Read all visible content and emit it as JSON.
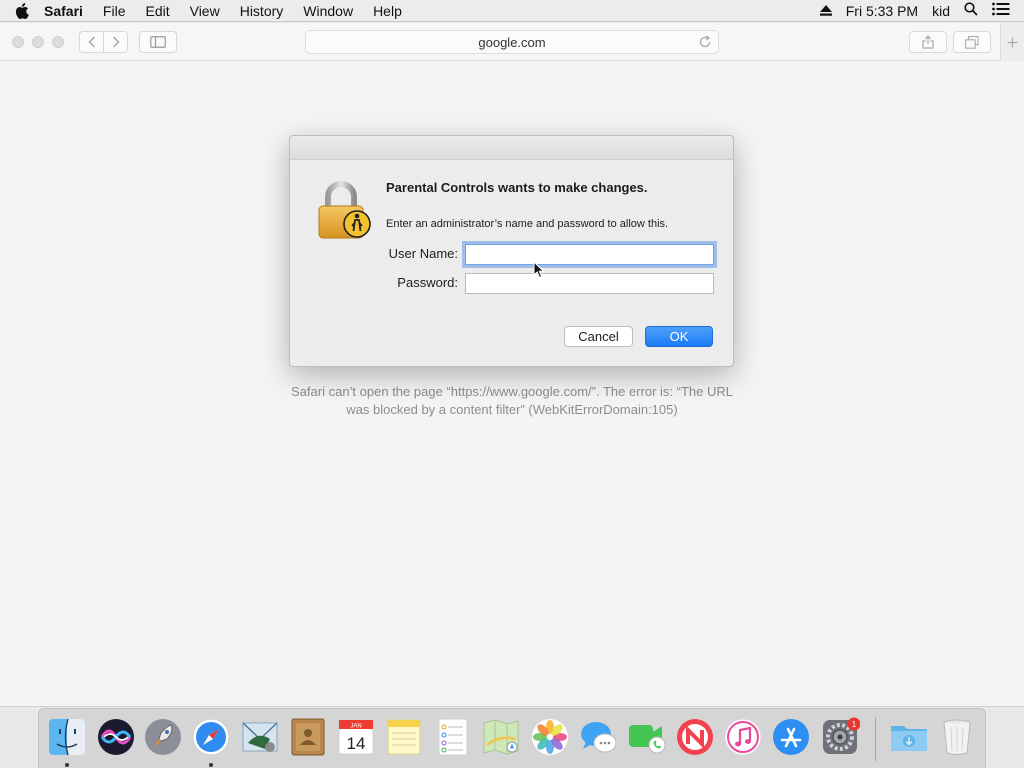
{
  "menubar": {
    "app_name": "Safari",
    "items": [
      "File",
      "Edit",
      "View",
      "History",
      "Window",
      "Help"
    ],
    "clock": "Fri 5:33 PM",
    "user": "kid"
  },
  "browser": {
    "address": "google.com",
    "error_message": "Safari can’t open the page “https://www.google.com/”. The error is: “The URL was blocked by a content filter” (WebKitErrorDomain:105)"
  },
  "dialog": {
    "heading": "Parental Controls wants to make changes.",
    "subtext": "Enter an administrator’s name and password to allow this.",
    "username_label": "User Name:",
    "username_value": "",
    "password_label": "Password:",
    "password_value": "",
    "cancel_label": "Cancel",
    "ok_label": "OK"
  },
  "dock": {
    "items": [
      "finder",
      "siri",
      "launchpad",
      "safari",
      "mail",
      "contacts",
      "calendar",
      "notes",
      "reminders",
      "maps",
      "photos",
      "messages",
      "facetime",
      "news",
      "itunes",
      "app-store",
      "system-preferences",
      "downloads",
      "trash"
    ],
    "calendar_month": "JAN",
    "calendar_day": "14",
    "system_preferences_badge": "1"
  },
  "colors": {
    "accent": "#1b7cf5",
    "focus_ring": "#6ea3e6",
    "badge": "#e8372f"
  }
}
